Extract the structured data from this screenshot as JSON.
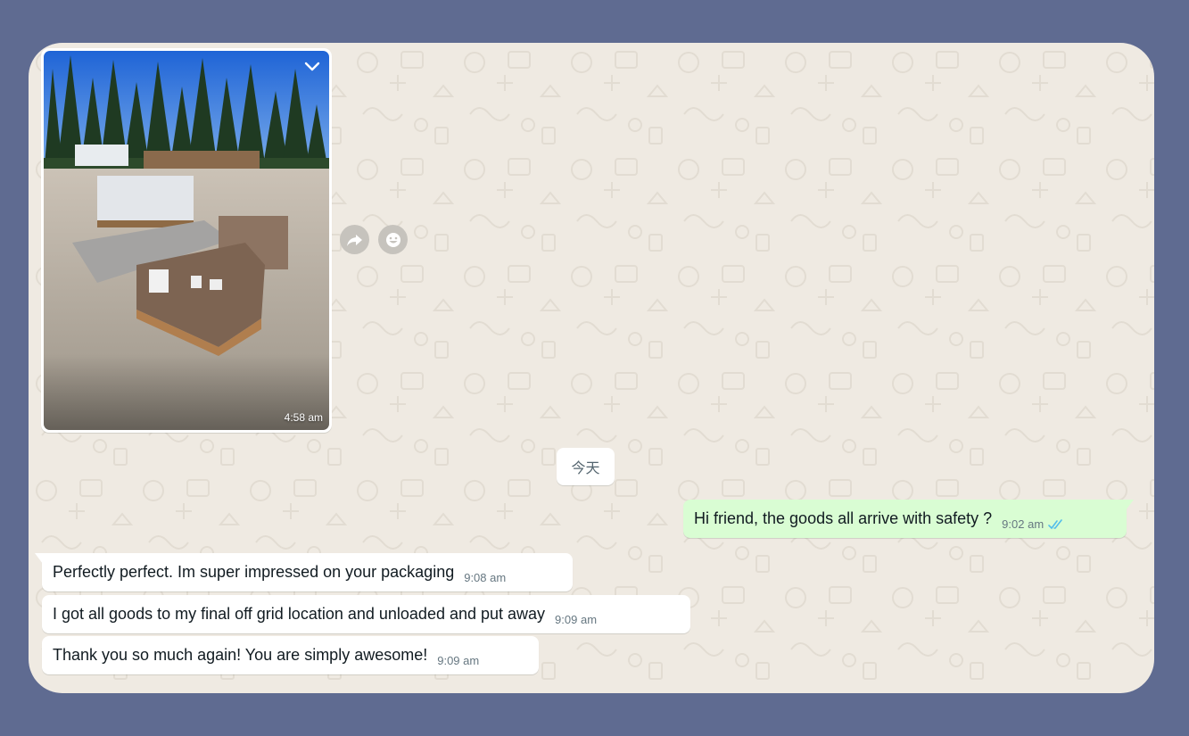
{
  "chat": {
    "image_message": {
      "time": "4:58 am",
      "menu_icon": "chevron-down-icon"
    },
    "actions": {
      "forward_icon": "forward-icon",
      "react_icon": "emoji-icon"
    },
    "date_divider": "今天",
    "messages": [
      {
        "direction": "outgoing",
        "text": "Hi friend,  the goods all arrive with safety ?",
        "time": "9:02 am",
        "status": "read"
      },
      {
        "direction": "incoming",
        "text": "Perfectly perfect. Im super impressed on your packaging",
        "time": "9:08 am"
      },
      {
        "direction": "incoming",
        "text": "I got all goods to my final off grid location and unloaded and put away",
        "time": "9:09 am"
      },
      {
        "direction": "incoming",
        "text": "Thank you so much again! You are simply awesome!",
        "time": "9:09 am"
      }
    ]
  },
  "colors": {
    "page_background": "#5f6b91",
    "chat_background": "#efeae2",
    "outgoing_bubble": "#d9fdd3",
    "incoming_bubble": "#ffffff",
    "read_ticks": "#53bdeb"
  }
}
